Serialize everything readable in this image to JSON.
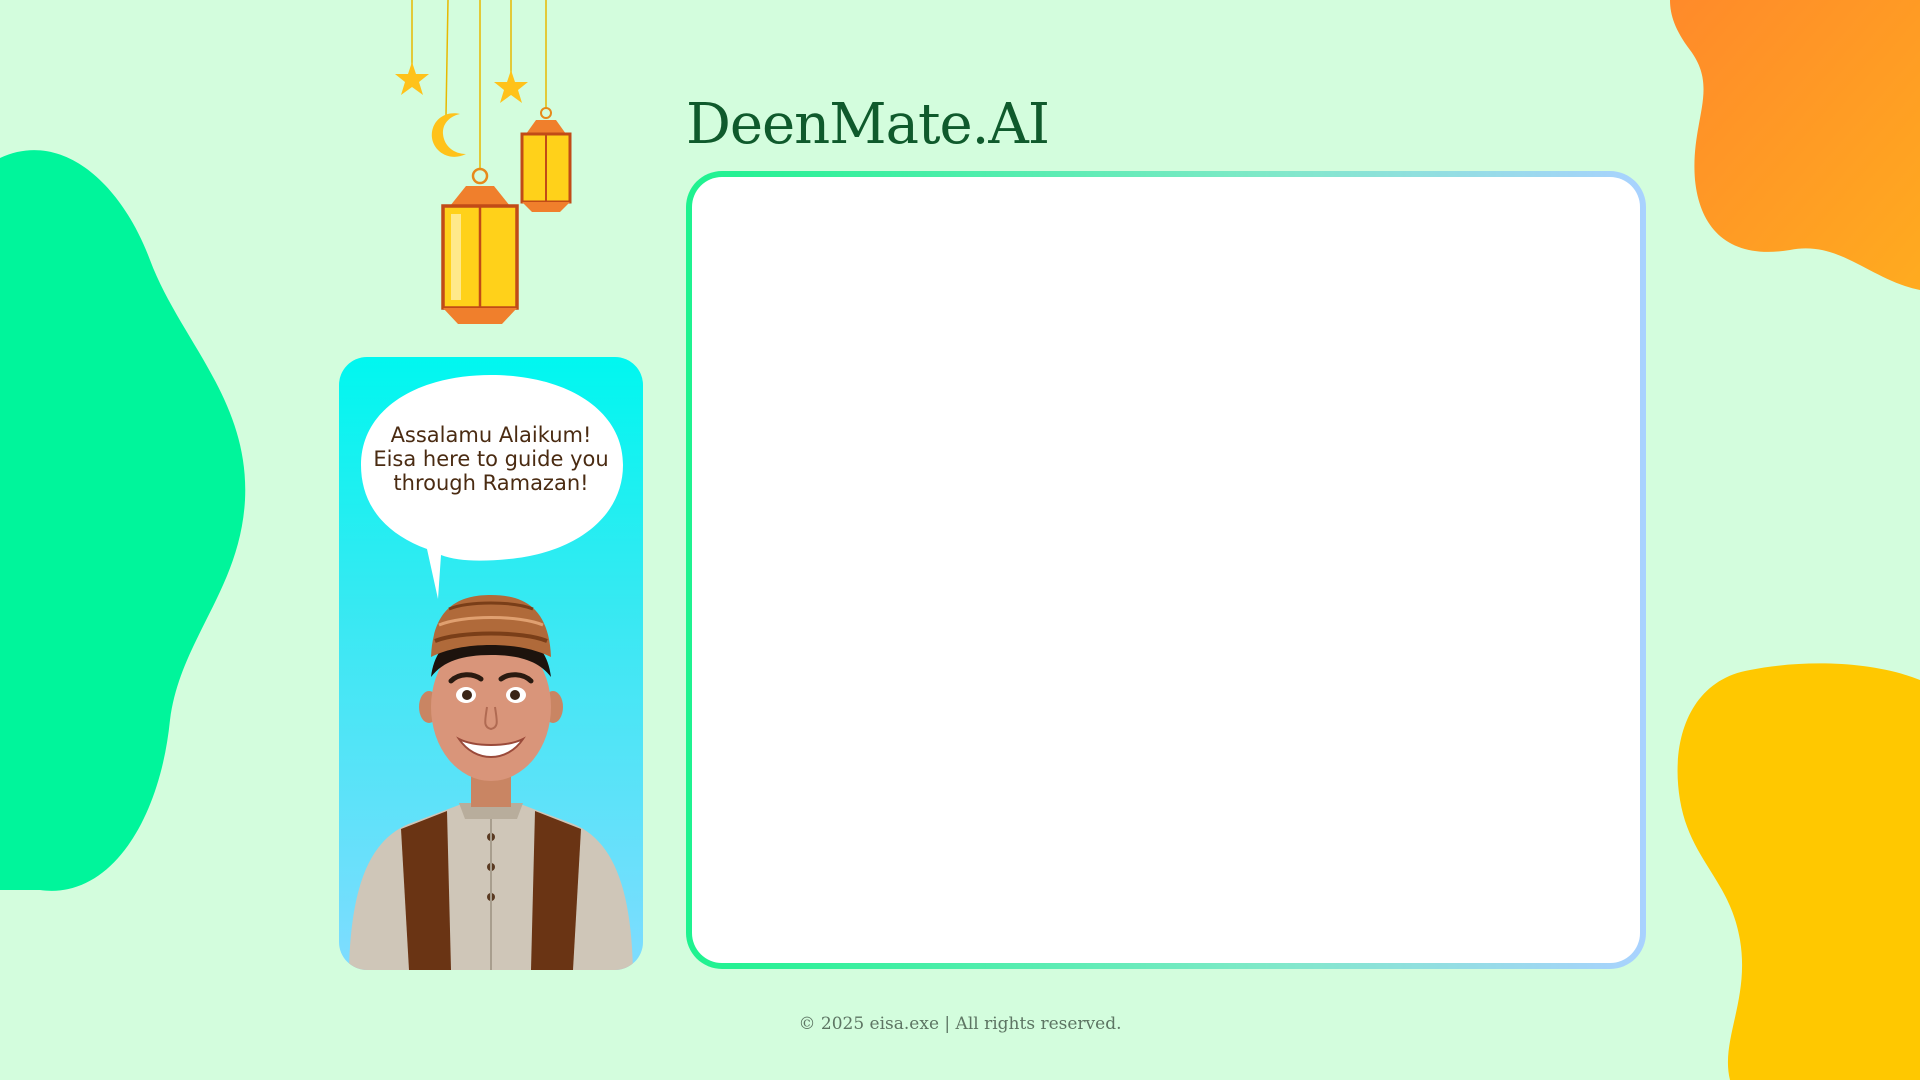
{
  "app": {
    "brand_title": "DeenMate.AI"
  },
  "assistant": {
    "greeting_lines": [
      "Assalamu Alaikum!",
      "Eisa here to guide you",
      "through Ramazan!"
    ],
    "avatar": "smiling-boy-in-kufi-avatar"
  },
  "chat": {
    "panel": "empty-chat-panel"
  },
  "footer": {
    "copyright": "© 2025 eisa.exe | All rights reserved."
  },
  "decor": {
    "icons": [
      "star-icon",
      "crescent-moon-icon",
      "lantern-icon"
    ]
  },
  "colors": {
    "background": "#d3fddd",
    "brand_text": "#0f5a2c",
    "blob_green": "#00f59b",
    "blob_orange": "#ff8a2a",
    "blob_yellow": "#ffc800",
    "card_top": "#00f7f0",
    "card_bottom": "#7fdcff",
    "speech_text": "#4a2b12"
  }
}
